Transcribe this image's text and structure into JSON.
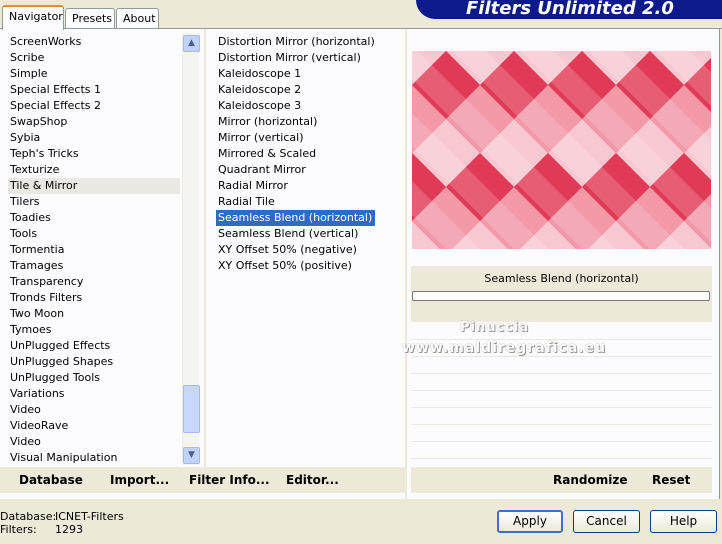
{
  "tabs": [
    {
      "label": "Navigator"
    },
    {
      "label": "Presets"
    },
    {
      "label": "About"
    }
  ],
  "brand": "Filters Unlimited 2.0",
  "categories": [
    "ScreenWorks",
    "Scribe",
    "Simple",
    "Special Effects 1",
    "Special Effects 2",
    "SwapShop",
    "Sybia",
    "Teph's Tricks",
    "Texturize",
    "Tile & Mirror",
    "Tilers",
    "Toadies",
    "Tools",
    "Tormentia",
    "Tramages",
    "Transparency",
    "Tronds Filters",
    "Two Moon",
    "Tymoes",
    "UnPlugged Effects",
    "UnPlugged Shapes",
    "UnPlugged Tools",
    "Variations",
    "Video",
    "VideoRave",
    "Video",
    "Visual Manipulation"
  ],
  "selected_category": "Tile & Mirror",
  "filters": [
    "Distortion Mirror (horizontal)",
    "Distortion Mirror (vertical)",
    "Kaleidoscope 1",
    "Kaleidoscope 2",
    "Kaleidoscope 3",
    "Mirror (horizontal)",
    "Mirror (vertical)",
    "Mirrored & Scaled",
    "Quadrant Mirror",
    "Radial Mirror",
    "Radial Tile",
    "Seamless Blend (horizontal)",
    "Seamless Blend (vertical)",
    "XY Offset 50% (negative)",
    "XY Offset 50% (positive)"
  ],
  "selected_filter": "Seamless Blend (horizontal)",
  "preview": {
    "filter_name": "Seamless Blend (horizontal)",
    "colors": {
      "red": "#e13b56",
      "pink": "#f4a9b5",
      "light": "#fbe2e6"
    }
  },
  "watermark": {
    "line1": "Pinuccia",
    "line2": "www.maldiregrafica.eu"
  },
  "bottom_links": {
    "database": "Database",
    "import": "Import...",
    "filter_info": "Filter Info...",
    "editor": "Editor...",
    "randomize": "Randomize",
    "reset": "Reset"
  },
  "footer": {
    "database_label": "Database:",
    "database_value": "ICNET-Filters",
    "filters_label": "Filters:",
    "filters_value": "1293"
  },
  "buttons": {
    "apply": "Apply",
    "cancel": "Cancel",
    "help": "Help"
  }
}
